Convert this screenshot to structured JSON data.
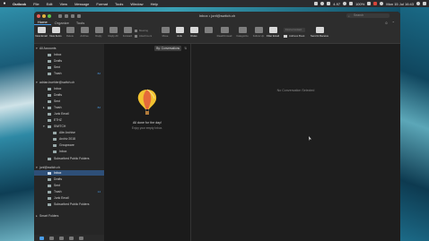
{
  "menubar": {
    "app_name": "Outlook",
    "items": [
      "File",
      "Edit",
      "View",
      "Message",
      "Format",
      "Tools",
      "Window",
      "Help"
    ],
    "status_temp": "4.97",
    "battery": "100%",
    "clock": "Mon 15 Jul 16:43"
  },
  "window": {
    "title": "Inbox • jonf@switch.ch",
    "search_placeholder": "Search"
  },
  "tabs": [
    "Home",
    "Organize",
    "Tools"
  ],
  "ribbon": {
    "new_email": "New Email",
    "new_items": "New Items",
    "delete": "Delete",
    "archive": "Archive",
    "reply": "Reply",
    "reply_all": "Reply All",
    "forward": "Forward",
    "meeting": "Meeting",
    "attachment": "Attachment",
    "move": "Move",
    "junk": "Junk",
    "rules": "Rules",
    "read_unread": "Read/Unread",
    "categorize": "Categorize",
    "follow_up": "Follow Up",
    "filter_email": "Filter Email",
    "find_contact": "Find a Contact",
    "address_book": "Address Book",
    "send_receive": "Send & Receive"
  },
  "sidebar": {
    "all_accounts": "All Accounts",
    "all_folders": [
      "Inbox",
      "Drafts",
      "Sent",
      "Trash"
    ],
    "all_trash_count": "82",
    "account1": "adrian.buehler@switch.ch",
    "account1_folders": [
      "Inbox",
      "Drafts",
      "Sent",
      "Trash",
      "Junk Email",
      "ETHZ",
      "SWITCH"
    ],
    "account1_trash_count": "82",
    "switch_subfolders": [
      "Alte Archive",
      "Archiv 2018",
      "Groupware",
      "Inbox"
    ],
    "account1_subscribed": "Subscribed Public Folders",
    "account2": "jonf@switch.ch",
    "account2_folders": [
      "Inbox",
      "Drafts",
      "Sent",
      "Trash",
      "Junk Email"
    ],
    "account2_trash_count": "14",
    "account2_subscribed": "Subscribed Public Folders",
    "smart_folders": "Smart Folders"
  },
  "message_list": {
    "filter_label": "By: Conversations",
    "sort_icon": "sort-arrows-icon",
    "empty_title": "All done for the day!",
    "empty_subtitle": "Enjoy your empty Inbox."
  },
  "reading_pane": {
    "empty_text": "No Conversation Selected"
  },
  "colors": {
    "accent": "#4a9de8",
    "selection": "#2e4f78",
    "window_bg": "#1e1e1e"
  }
}
